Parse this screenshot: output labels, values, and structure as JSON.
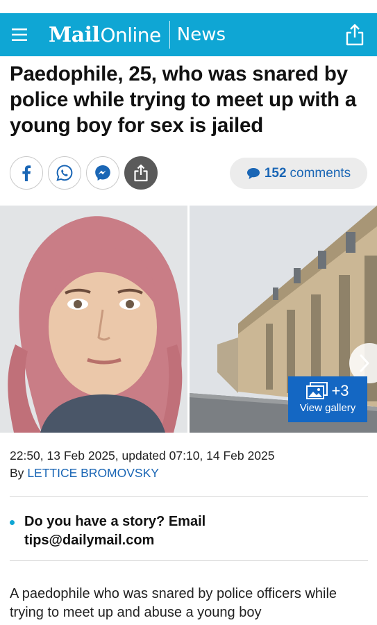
{
  "header": {
    "logo_mail": "Mail",
    "logo_online": "Online",
    "section": "News"
  },
  "article": {
    "headline": "Paedophile, 25, who was snared by police while trying to meet up with a young boy for sex is jailed",
    "comments_count": "152",
    "comments_word": "comments",
    "gallery_count": "+3",
    "gallery_label": "View gallery",
    "dateline": "22:50, 13 Feb 2025, updated 07:10, 14 Feb 2025",
    "by_prefix": "By",
    "author": "LETTICE BROMOVSKY",
    "tip": "Do you have a story? Email tips@dailymail.com",
    "body_start": "A paedophile who was snared by police officers while trying to meet up and abuse a young boy"
  },
  "colors": {
    "brand": "#0fa6d4",
    "link": "#1a66b5",
    "gallery": "#1467c3"
  },
  "icons": {
    "menu": "hamburger-icon",
    "share": "share-icon",
    "facebook": "facebook-icon",
    "whatsapp": "whatsapp-icon",
    "messenger": "messenger-icon",
    "comment": "speech-bubble-icon",
    "gallery": "image-stack-icon",
    "next": "chevron-right-icon"
  }
}
